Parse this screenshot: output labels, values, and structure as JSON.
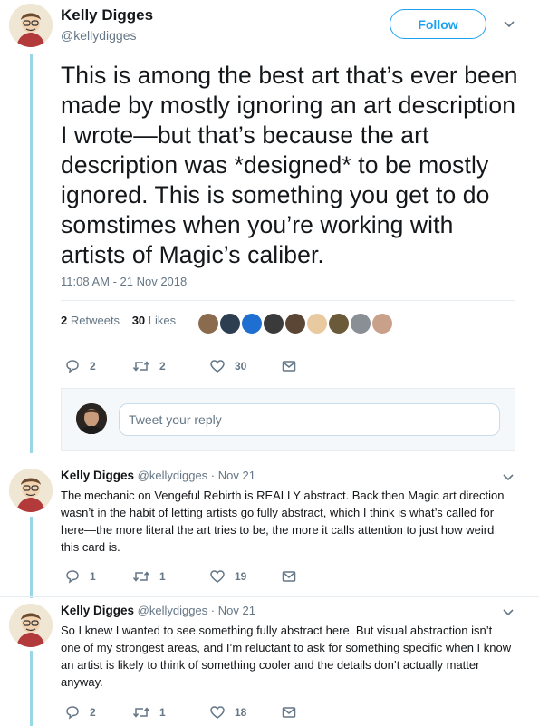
{
  "main_tweet": {
    "author_name": "Kelly Digges",
    "author_handle": "@kellydigges",
    "follow_label": "Follow",
    "text": "This is among the best art that’s ever been made by mostly ignoring an art description I wrote—but that’s because the art description was *designed* to be mostly ignored. This is something you get to do somstimes when you’re working with artists of Magic’s caliber.",
    "timestamp": "11:08 AM - 21 Nov 2018",
    "retweets_count": "2",
    "retweets_label": "Retweets",
    "likes_count": "30",
    "likes_label": "Likes",
    "actions": {
      "replies": "2",
      "retweets": "2",
      "likes": "30"
    }
  },
  "likers": [
    {
      "color": "#8b6b4e",
      "icon": "liker-avatar"
    },
    {
      "color": "#2c3e50",
      "icon": "liker-avatar"
    },
    {
      "color": "#1f6fd1",
      "icon": "liker-avatar"
    },
    {
      "color": "#3a3a3a",
      "icon": "liker-avatar"
    },
    {
      "color": "#5b4636",
      "icon": "liker-avatar"
    },
    {
      "color": "#e8c9a0",
      "icon": "liker-avatar"
    },
    {
      "color": "#6a5a3a",
      "icon": "liker-avatar"
    },
    {
      "color": "#8a8f96",
      "icon": "liker-avatar"
    },
    {
      "color": "#c9a18a",
      "icon": "liker-avatar"
    }
  ],
  "reply_box": {
    "placeholder": "Tweet your reply"
  },
  "replies": [
    {
      "author_name": "Kelly Digges",
      "author_handle": "@kellydigges",
      "date": "· Nov 21",
      "text": "The mechanic on Vengeful Rebirth is REALLY abstract. Back then Magic art direction wasn’t in the habit of letting artists go fully abstract, which I think is what’s called for here—the more literal the art tries to be, the more it calls attention to just how weird this card is.",
      "replies": "1",
      "retweets": "1",
      "likes": "19"
    },
    {
      "author_name": "Kelly Digges",
      "author_handle": "@kellydigges",
      "date": "· Nov 21",
      "text": "So I knew I wanted to see something fully abstract here. But visual abstraction isn’t one of my strongest areas, and I’m reluctant to ask for something specific when I know an artist is likely to think of something cooler and the details don’t actually matter anyway.",
      "replies": "2",
      "retweets": "1",
      "likes": "18"
    }
  ],
  "colors": {
    "accent": "#1da1f2",
    "thread_line": "#99d7e6",
    "muted": "#657786"
  }
}
